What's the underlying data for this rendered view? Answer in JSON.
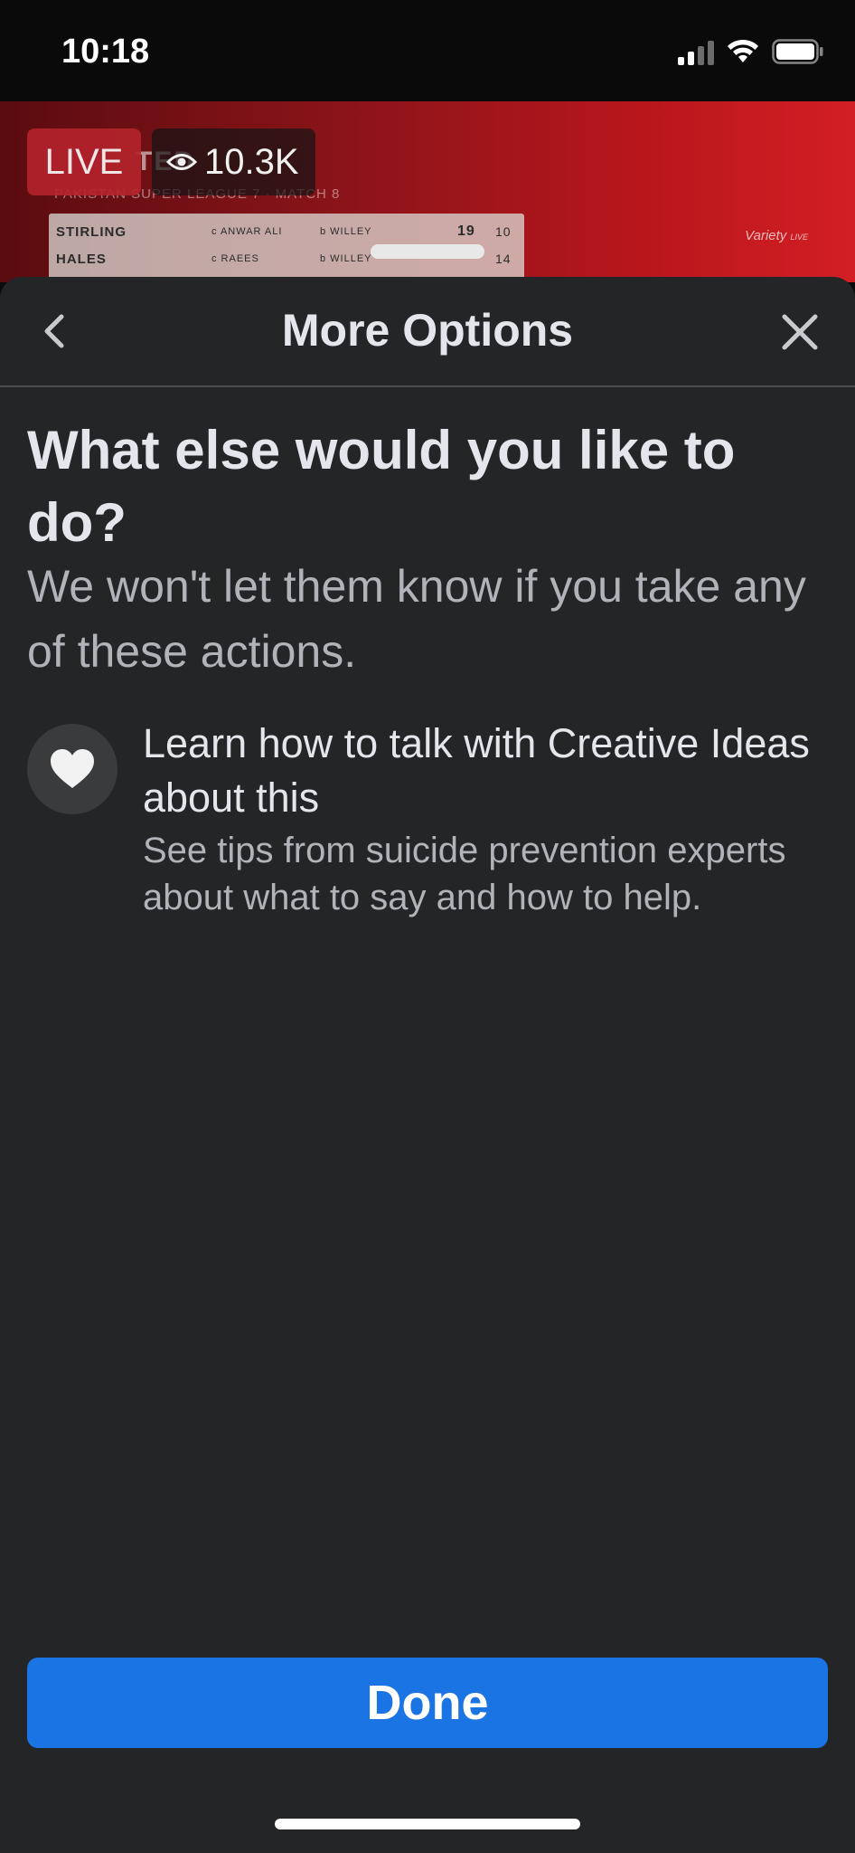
{
  "status_bar": {
    "time": "10:18",
    "icons": [
      "cellular-signal-icon",
      "wifi-icon",
      "battery-icon"
    ]
  },
  "background_video": {
    "live_badge": "LIVE",
    "viewer_count": "10.3K",
    "match_title": "TED",
    "match_subtitle": "PAKISTAN SUPER LEAGUE 7 · MATCH 8",
    "scoreboard": [
      {
        "name": "STIRLING",
        "how": "c ANWAR ALI",
        "bowler": "b WILLEY",
        "runs": "19",
        "balls": "10"
      },
      {
        "name": "HALES",
        "how": "c RAEES",
        "bowler": "b WILLEY",
        "runs": "",
        "balls": "14"
      }
    ],
    "watermark": "Variety",
    "watermark_small": "LIVE"
  },
  "sheet": {
    "title": "More Options",
    "back_icon": "chevron-left-icon",
    "close_icon": "close-icon",
    "question": "What else would you like to do?",
    "subtext": "We won't let them know if you take any of these actions.",
    "option": {
      "icon": "heart-icon",
      "title": "Learn how to talk with Creative Ideas about this",
      "description": "See tips from suicide prevention experts about what to say and how to help."
    },
    "done_label": "Done"
  },
  "colors": {
    "sheet_background": "#242527",
    "primary_button": "#1b74e4",
    "live_badge": "#b5232c",
    "primary_text": "#e4e6eb",
    "secondary_text": "#b0b3b8"
  }
}
